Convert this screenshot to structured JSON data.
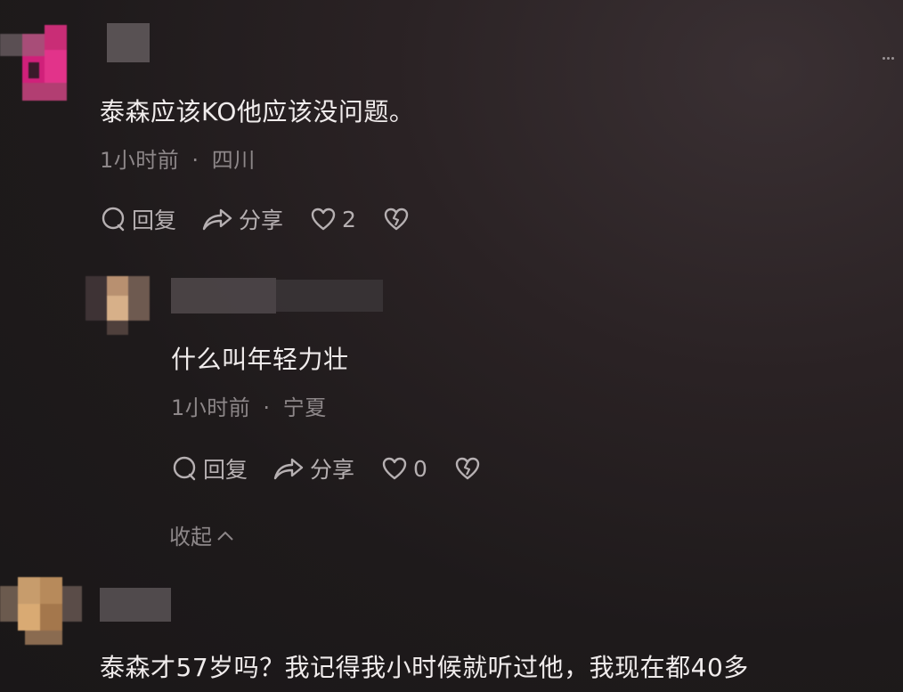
{
  "comments": [
    {
      "text": "泰森应该KO他应该没问题。",
      "time": "1小时前",
      "location": "四川",
      "reply_label": "回复",
      "share_label": "分享",
      "likes": "2"
    }
  ],
  "reply": {
    "text": "什么叫年轻力壮",
    "time": "1小时前",
    "location": "宁夏",
    "reply_label": "回复",
    "share_label": "分享",
    "likes": "0",
    "collapse_label": "收起"
  },
  "comment3": {
    "text": "泰森才57岁吗？我记得我小时候就听过他，我现在都40多"
  },
  "separator": "·",
  "colors": {
    "background": "#1e1a1b",
    "primary_text": "#f0ecec",
    "meta_text": "#8d8789",
    "action_text": "#b6b0b2"
  }
}
